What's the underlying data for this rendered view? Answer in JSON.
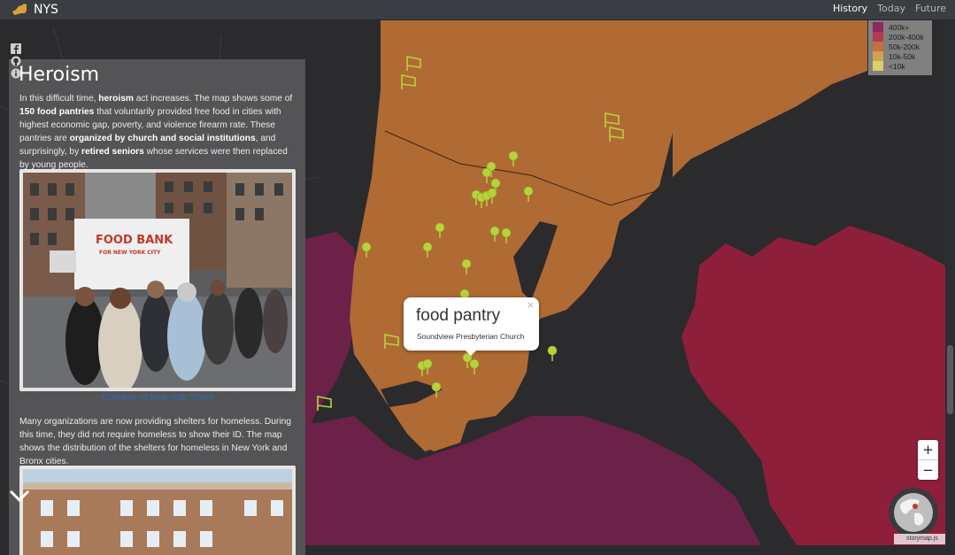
{
  "nav": {
    "brand": "NYS",
    "links": [
      {
        "label": "History",
        "active": true
      },
      {
        "label": "Today",
        "active": false
      },
      {
        "label": "Future",
        "active": false
      }
    ]
  },
  "story": {
    "title": "Heroism",
    "intro": {
      "t1": "In this difficult time, ",
      "b1": "heroism",
      "t2": " act increases. The map shows some of ",
      "b2": "150 food pantries",
      "t3": " that voluntarily provided free food in cities with highest economic gap, poverty, and violence firearm rate. These pantries are ",
      "b3": "organized by church and social institutions",
      "t4": ", and surprisingly, by ",
      "b4": "retired seniors",
      "t5": " whose services were then replaced by young people."
    },
    "photo1": {
      "truck_text_line1": "FOOD BANK",
      "truck_text_line2": "FOR NEW YORK CITY"
    },
    "caption": "Courtesy of New York Times",
    "paragraph2": "Many organizations are now providing shelters for homeless. During this time, they did not require homeless to show their ID. The map shows the distribution of the shelters for homeless in New York and Bronx cities."
  },
  "legend": {
    "items": [
      {
        "label": "400k+",
        "color": "#8b2a5b"
      },
      {
        "label": "200k-400k",
        "color": "#b23a52"
      },
      {
        "label": "50k-200k",
        "color": "#c4713f"
      },
      {
        "label": "10k-50k",
        "color": "#d4a052"
      },
      {
        "label": "<10k",
        "color": "#d8d06a"
      }
    ]
  },
  "popup": {
    "title": "food pantry",
    "subtitle": "Soundview Presbyterian Church",
    "close": "×"
  },
  "zoom": {
    "in": "+",
    "out": "−"
  },
  "credit": "storymap.js",
  "map": {
    "colors": {
      "water": "#2b2b2d",
      "orange": "#b06a34",
      "crimson": "#8e1f3b",
      "purple": "#6b2148",
      "marker": "#b6d33c"
    }
  }
}
